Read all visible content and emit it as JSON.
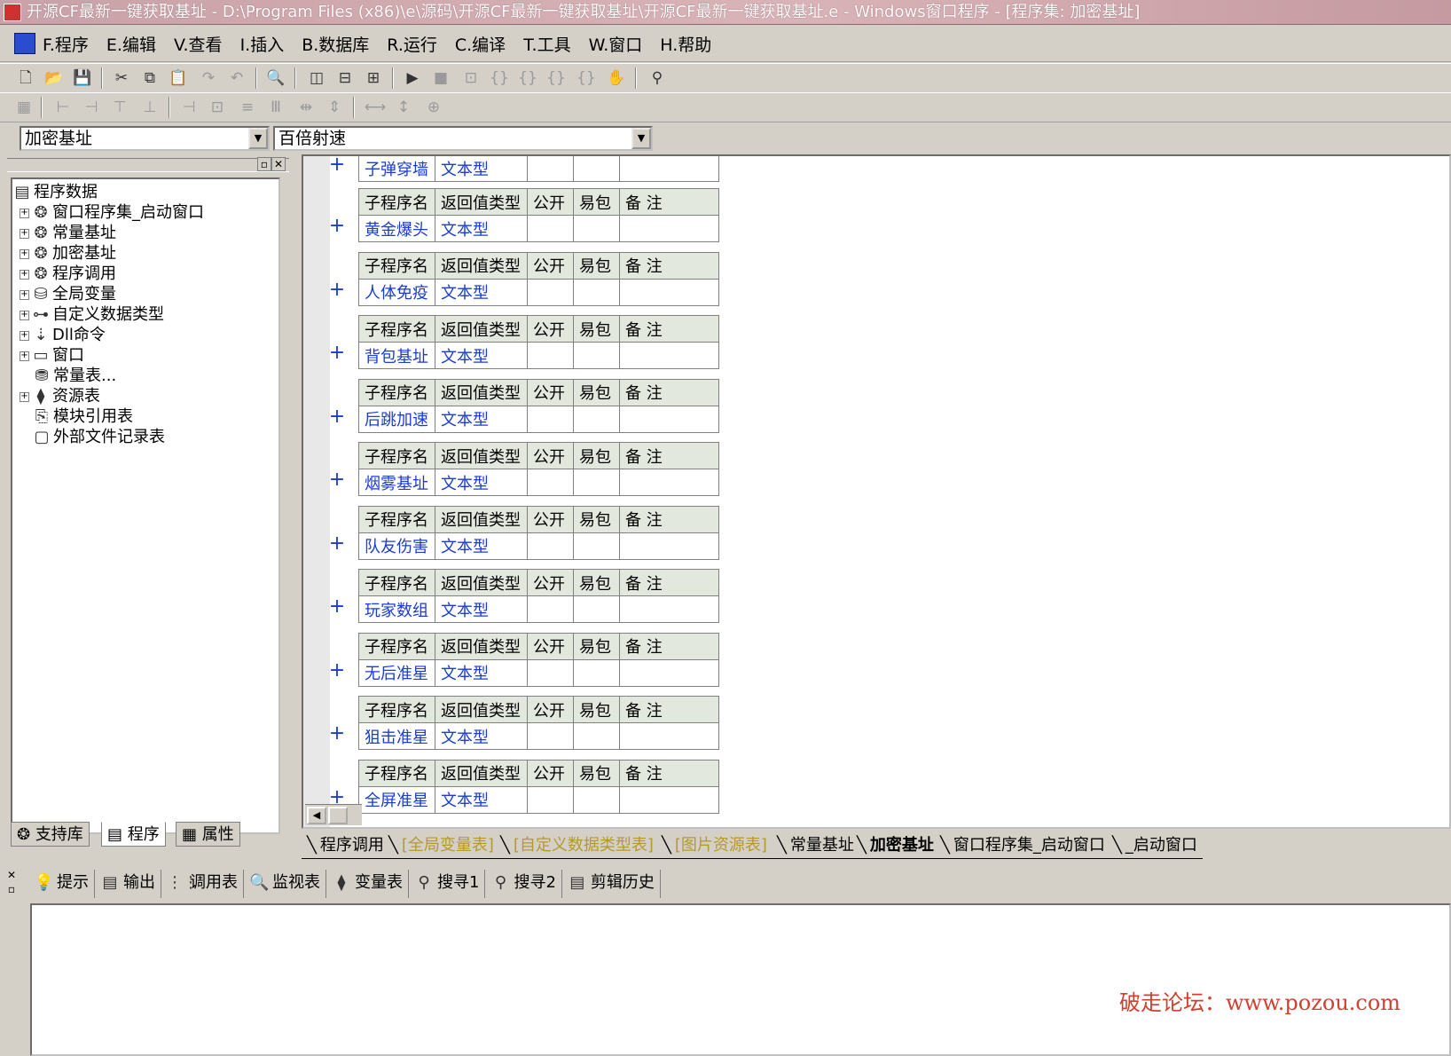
{
  "window": {
    "title": "开源CF最新一键获取基址 - D:\\Program Files (x86)\\e\\源码\\开源CF最新一键获取基址\\开源CF最新一键获取基址.e - Windows窗口程序 - [程序集: 加密基址]"
  },
  "menu": [
    "F.程序",
    "E.编辑",
    "V.查看",
    "I.插入",
    "B.数据库",
    "R.运行",
    "C.编译",
    "T.工具",
    "W.窗口",
    "H.帮助"
  ],
  "combos": {
    "left": "加密基址",
    "right": "百倍射速"
  },
  "tree": {
    "root": "程序数据",
    "items": [
      "窗口程序集_启动窗口",
      "常量基址",
      "加密基址",
      "程序调用",
      "全局变量",
      "自定义数据类型",
      "Dll命令",
      "窗口",
      "常量表...",
      "资源表",
      "模块引用表",
      "外部文件记录表"
    ]
  },
  "left_tabs": [
    "支持库",
    "程序",
    "属性"
  ],
  "table_headers": [
    "子程序名",
    "返回值类型",
    "公开",
    "易包",
    "备 注"
  ],
  "subroutines": [
    {
      "name": "子弹穿墙",
      "type": "文本型"
    },
    {
      "name": "黄金爆头",
      "type": "文本型"
    },
    {
      "name": "人体免疫",
      "type": "文本型"
    },
    {
      "name": "背包基址",
      "type": "文本型"
    },
    {
      "name": "后跳加速",
      "type": "文本型"
    },
    {
      "name": "烟雾基址",
      "type": "文本型"
    },
    {
      "name": "队友伤害",
      "type": "文本型"
    },
    {
      "name": "玩家数组",
      "type": "文本型"
    },
    {
      "name": "无后准星",
      "type": "文本型"
    },
    {
      "name": "狙击准星",
      "type": "文本型"
    },
    {
      "name": "全屏准星",
      "type": "文本型"
    }
  ],
  "plus_symbol": "+",
  "editor_tabs": [
    {
      "label": "程序调用",
      "style": "normal"
    },
    {
      "label": "[全局变量表]",
      "style": "yellow"
    },
    {
      "label": "[自定义数据类型表]",
      "style": "yellow"
    },
    {
      "label": "[图片资源表]",
      "style": "yellow"
    },
    {
      "label": "常量基址",
      "style": "normal"
    },
    {
      "label": "加密基址",
      "style": "active"
    },
    {
      "label": "窗口程序集_启动窗口",
      "style": "normal"
    },
    {
      "label": "_启动窗口",
      "style": "normal"
    }
  ],
  "output_tabs": [
    "提示",
    "输出",
    "调用表",
    "监视表",
    "变量表",
    "搜寻1",
    "搜寻2",
    "剪辑历史"
  ],
  "watermark": "破走论坛：www.pozou.com",
  "colors": {
    "link_blue": "#1a3ccf",
    "header_bg": "#e3e8df",
    "tab_yellow": "#b59a2a",
    "watermark_red": "#d04030"
  }
}
